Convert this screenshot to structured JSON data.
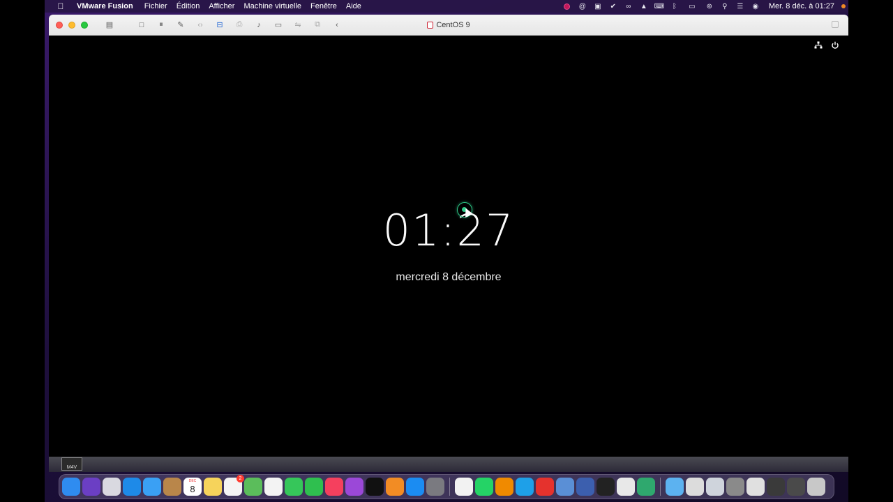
{
  "menubar": {
    "apple_icon": "apple-icon",
    "app_name": "VMware Fusion",
    "items": [
      "Fichier",
      "Édition",
      "Afficher",
      "Machine virtuelle",
      "Fenêtre",
      "Aide"
    ],
    "status_icons": [
      "screen-record-icon",
      "at-sign-icon",
      "vmware-tray-icon",
      "checkmark-icon",
      "creative-cloud-icon",
      "upload-icon",
      "keyboard-viewer-icon",
      "bluetooth-icon",
      "battery-icon",
      "screen-mirroring-icon",
      "search-icon",
      "control-center-icon",
      "siri-icon"
    ],
    "clock": "Mer. 8 déc. à  01:27"
  },
  "window": {
    "title": "CentOS 9",
    "toolbar": [
      {
        "name": "library-icon",
        "glyph": "▤",
        "state": "normal"
      },
      {
        "name": "stop-icon",
        "glyph": "□",
        "state": "normal"
      },
      {
        "name": "pause-icon",
        "glyph": "⏸",
        "state": "normal"
      },
      {
        "name": "settings-wrench-icon",
        "glyph": "✎",
        "state": "normal"
      },
      {
        "name": "network-icon",
        "glyph": "‹›",
        "state": "dim"
      },
      {
        "name": "hard-disk-icon",
        "glyph": "⊟",
        "state": "blue"
      },
      {
        "name": "printer-icon",
        "glyph": "⎙",
        "state": "dim"
      },
      {
        "name": "sound-icon",
        "glyph": "♪",
        "state": "normal"
      },
      {
        "name": "camera-icon",
        "glyph": "▭",
        "state": "normal"
      },
      {
        "name": "usb-icon",
        "glyph": "⇋",
        "state": "dim"
      },
      {
        "name": "shared-folder-icon",
        "glyph": "⧉",
        "state": "dim"
      },
      {
        "name": "back-chevron-icon",
        "glyph": "‹",
        "state": "normal"
      }
    ]
  },
  "guest": {
    "tray_icons": [
      "network-wired-icon",
      "power-icon"
    ],
    "time": "01:27",
    "date": "mercredi 8 décembre"
  },
  "strip": {
    "file_badge": "M4V"
  },
  "dock": {
    "calendar_month": "DEC",
    "calendar_day": "8",
    "reminders_badge": "2",
    "apps": [
      {
        "name": "finder-icon",
        "color": "#2f8cf0"
      },
      {
        "name": "siri-icon",
        "color": "#6b3fc4"
      },
      {
        "name": "launchpad-icon",
        "color": "#d9d9e0"
      },
      {
        "name": "safari-icon",
        "color": "#1e8ae8"
      },
      {
        "name": "mail-icon",
        "color": "#3aa0f4"
      },
      {
        "name": "contacts-icon",
        "color": "#b9864a"
      },
      {
        "name": "calendar-icon",
        "color": "#ffffff"
      },
      {
        "name": "notes-icon",
        "color": "#f6d35b"
      },
      {
        "name": "reminders-icon",
        "color": "#f4f4f4"
      },
      {
        "name": "maps-icon",
        "color": "#5bbd5b"
      },
      {
        "name": "photos-icon",
        "color": "#f3f3f3"
      },
      {
        "name": "messages-icon",
        "color": "#36c65a"
      },
      {
        "name": "facetime-icon",
        "color": "#2fbf4f"
      },
      {
        "name": "music-icon",
        "color": "#f5405e"
      },
      {
        "name": "podcasts-icon",
        "color": "#9b48d8"
      },
      {
        "name": "apple-tv-icon",
        "color": "#111111"
      },
      {
        "name": "books-icon",
        "color": "#f28c24"
      },
      {
        "name": "app-store-icon",
        "color": "#1b8cf2"
      },
      {
        "name": "system-preferences-icon",
        "color": "#7a7a80"
      },
      {
        "name": "chrome-icon",
        "color": "#f2f2f2"
      },
      {
        "name": "whatsapp-icon",
        "color": "#25d366"
      },
      {
        "name": "vlc-icon",
        "color": "#f08a00"
      },
      {
        "name": "skype-icon",
        "color": "#1ea0e8"
      },
      {
        "name": "anydesk-icon",
        "color": "#e5322d"
      },
      {
        "name": "preview-icon",
        "color": "#5a8fd6"
      },
      {
        "name": "vmware-fusion-icon",
        "color": "#3c5fae"
      },
      {
        "name": "terminal-icon",
        "color": "#222222"
      },
      {
        "name": "text-edit-icon",
        "color": "#e8e8e8"
      },
      {
        "name": "filmora-icon",
        "color": "#2fa86e"
      },
      {
        "name": "downloads-folder-icon",
        "color": "#5cb2f0"
      },
      {
        "name": "document-stack-icon-1",
        "color": "#dcdcdc"
      },
      {
        "name": "document-stack-icon-2",
        "color": "#cfd4dc"
      },
      {
        "name": "document-stack-icon-3",
        "color": "#8a8a8a"
      },
      {
        "name": "document-stack-icon-4",
        "color": "#e0e0e0"
      },
      {
        "name": "document-stack-icon-5",
        "color": "#3a3a3a"
      },
      {
        "name": "document-stack-icon-6",
        "color": "#4a4a4a"
      },
      {
        "name": "trash-icon",
        "color": "#c8c8c8"
      }
    ]
  }
}
